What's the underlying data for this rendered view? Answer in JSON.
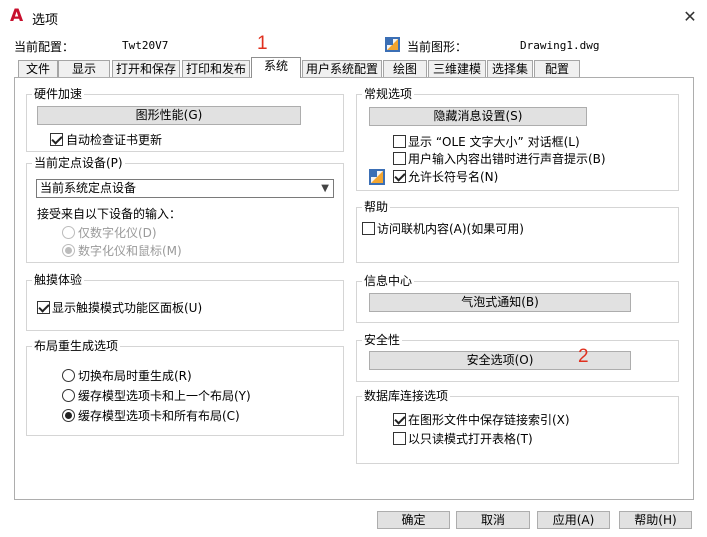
{
  "window": {
    "title": "选项",
    "close_glyph": "✕"
  },
  "header": {
    "profile_label": "当前配置：",
    "profile_value": "Twt20V7",
    "drawing_label": "当前图形：",
    "drawing_value": "Drawing1.dwg"
  },
  "annotations": {
    "one": "1",
    "two": "2"
  },
  "tabs": [
    "文件",
    "显示",
    "打开和保存",
    "打印和发布",
    "系统",
    "用户系统配置",
    "绘图",
    "三维建模",
    "选择集",
    "配置"
  ],
  "active_tab": "系统",
  "hardware": {
    "title": "硬件加速",
    "graphics_button": "图形性能(G)",
    "auto_check_label": "自动检查证书更新",
    "auto_check_checked": true
  },
  "pointing": {
    "title": "当前定点设备(P)",
    "select_value": "当前系统定点设备",
    "accept_label": "接受来自以下设备的输入：",
    "options": [
      "仅数字化仪(D)",
      "数字化仪和鼠标(M)"
    ],
    "selected_index": 1
  },
  "touch": {
    "title": "触摸体验",
    "show_touch_label": "显示触摸模式功能区面板(U)",
    "show_touch_checked": true
  },
  "layout_regen": {
    "title": "布局重生成选项",
    "options": [
      "切换布局时重生成(R)",
      "缓存模型选项卡和上一个布局(Y)",
      "缓存模型选项卡和所有布局(C)"
    ],
    "selected_index": 2
  },
  "general": {
    "title": "常规选项",
    "hidden_messages_button": "隐藏消息设置(S)",
    "checkboxes": [
      {
        "label": "显示 “OLE 文字大小” 对话框(L)",
        "checked": false
      },
      {
        "label": "用户输入内容出错时进行声音提示(B)",
        "checked": false
      },
      {
        "label": "允许长符号名(N)",
        "checked": true
      }
    ]
  },
  "help": {
    "title": "帮助",
    "online_label": "访问联机内容(A)(如果可用)",
    "online_checked": false
  },
  "info_center": {
    "title": "信息中心",
    "balloon_button": "气泡式通知(B)"
  },
  "security": {
    "title": "安全性",
    "security_button": "安全选项(O)"
  },
  "db_connect": {
    "title": "数据库连接选项",
    "checkboxes": [
      {
        "label": "在图形文件中保存链接索引(X)",
        "checked": true
      },
      {
        "label": "以只读模式打开表格(T)",
        "checked": false
      }
    ]
  },
  "footer": {
    "ok": "确定",
    "cancel": "取消",
    "apply": "应用(A)",
    "help": "帮助(H)"
  },
  "colors": {
    "annotation": "#e0301e",
    "app_icon": "#c8102e",
    "button_face": "#e1e1e1"
  }
}
